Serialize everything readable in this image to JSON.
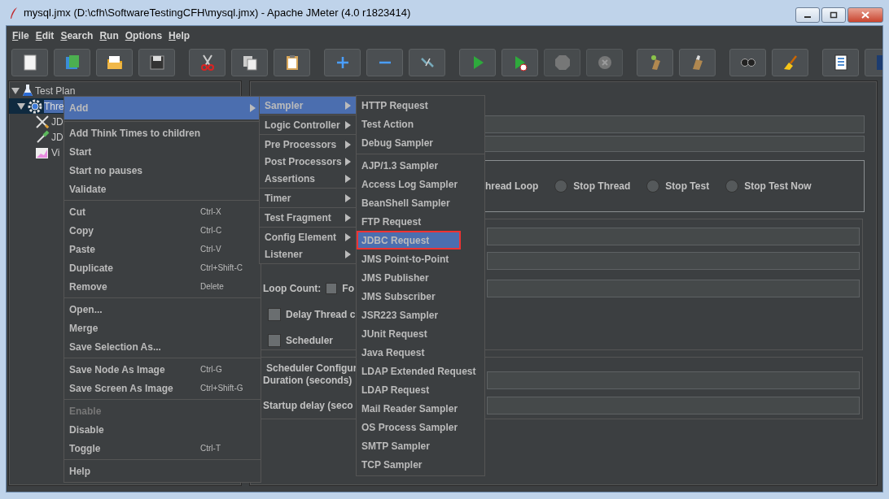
{
  "window": {
    "title": "mysql.jmx (D:\\cfh\\SoftwareTestingCFH\\mysql.jmx) - Apache JMeter (4.0 r1823414)"
  },
  "menu_bar": [
    "File",
    "Edit",
    "Search",
    "Run",
    "Options",
    "Help"
  ],
  "toolbar": [
    {
      "buttons": [
        {
          "kind": "new",
          "disabled": false
        },
        {
          "kind": "templates",
          "disabled": false
        },
        {
          "kind": "open",
          "disabled": false
        },
        {
          "kind": "save",
          "disabled": false
        }
      ]
    },
    {
      "buttons": [
        {
          "kind": "cut",
          "disabled": false
        },
        {
          "kind": "copy",
          "disabled": false
        },
        {
          "kind": "paste",
          "disabled": false
        }
      ]
    },
    {
      "buttons": [
        {
          "kind": "expand",
          "disabled": false
        },
        {
          "kind": "collapse",
          "disabled": false
        },
        {
          "kind": "toggle",
          "disabled": false
        }
      ]
    },
    {
      "buttons": [
        {
          "kind": "start",
          "disabled": false
        },
        {
          "kind": "start-no-pauses",
          "disabled": false
        },
        {
          "kind": "stop",
          "disabled": true
        },
        {
          "kind": "shutdown",
          "disabled": true
        }
      ]
    },
    {
      "buttons": [
        {
          "kind": "clear",
          "disabled": false
        },
        {
          "kind": "clear-all",
          "disabled": false
        }
      ]
    },
    {
      "buttons": [
        {
          "kind": "search",
          "disabled": false
        },
        {
          "kind": "reset-search",
          "disabled": false
        }
      ]
    },
    {
      "buttons": [
        {
          "kind": "function-helper",
          "disabled": false
        },
        {
          "kind": "help",
          "disabled": false
        }
      ]
    }
  ],
  "tree": [
    {
      "label": "Test Plan",
      "kind": "plan",
      "selected": false,
      "expanded": true,
      "children": [
        {
          "label": "Thre",
          "kind": "thread-group",
          "selected": true,
          "expanded": true,
          "children": [
            {
              "label": "JD",
              "kind": "config",
              "selected": false
            },
            {
              "label": "JD",
              "kind": "sampler",
              "selected": false
            },
            {
              "label": "Vi",
              "kind": "listener",
              "selected": false
            }
          ]
        }
      ]
    }
  ],
  "thread_group": {
    "action_partial_label": "hread Loop",
    "actions": [
      {
        "label": "Stop Thread",
        "selected": false
      },
      {
        "label": "Stop Test",
        "selected": false
      },
      {
        "label": "Stop Test Now",
        "selected": false
      }
    ],
    "loop_count": {
      "label": "Loop Count:",
      "checkbox_label": "Fo",
      "checked": false
    },
    "delay_thread": {
      "label": "Delay Thread c",
      "checked": false
    },
    "scheduler": {
      "label": "Scheduler",
      "checked": false
    },
    "scheduler_config": {
      "title": "Scheduler Configur",
      "duration_label": "Duration (seconds)",
      "startup_delay_label": "Startup delay (seco"
    }
  },
  "context_menu": {
    "groups": [
      {
        "items": [
          {
            "label": "Add",
            "submenu": true,
            "selected": true,
            "disabled": false
          }
        ]
      },
      {
        "items": [
          {
            "label": "Add Think Times to children",
            "submenu": false,
            "selected": false,
            "disabled": false
          },
          {
            "label": "Start",
            "submenu": false,
            "selected": false,
            "disabled": false
          },
          {
            "label": "Start no pauses",
            "submenu": false,
            "selected": false,
            "disabled": false
          },
          {
            "label": "Validate",
            "submenu": false,
            "selected": false,
            "disabled": false
          }
        ]
      },
      {
        "items": [
          {
            "label": "Cut",
            "shortcut": "Ctrl-X",
            "submenu": false,
            "selected": false,
            "disabled": false
          },
          {
            "label": "Copy",
            "shortcut": "Ctrl-C",
            "submenu": false,
            "selected": false,
            "disabled": false
          },
          {
            "label": "Paste",
            "shortcut": "Ctrl-V",
            "submenu": false,
            "selected": false,
            "disabled": false
          },
          {
            "label": "Duplicate",
            "shortcut": "Ctrl+Shift-C",
            "submenu": false,
            "selected": false,
            "disabled": false
          },
          {
            "label": "Remove",
            "shortcut": "Delete",
            "submenu": false,
            "selected": false,
            "disabled": false
          }
        ]
      },
      {
        "items": [
          {
            "label": "Open...",
            "submenu": false,
            "selected": false,
            "disabled": false
          },
          {
            "label": "Merge",
            "submenu": false,
            "selected": false,
            "disabled": false
          },
          {
            "label": "Save Selection As...",
            "submenu": false,
            "selected": false,
            "disabled": false
          }
        ]
      },
      {
        "items": [
          {
            "label": "Save Node As Image",
            "shortcut": "Ctrl-G",
            "submenu": false,
            "selected": false,
            "disabled": false
          },
          {
            "label": "Save Screen As Image",
            "shortcut": "Ctrl+Shift-G",
            "submenu": false,
            "selected": false,
            "disabled": false
          }
        ]
      },
      {
        "items": [
          {
            "label": "Enable",
            "submenu": false,
            "selected": false,
            "disabled": true
          },
          {
            "label": "Disable",
            "submenu": false,
            "selected": false,
            "disabled": false
          },
          {
            "label": "Toggle",
            "shortcut": "Ctrl-T",
            "submenu": false,
            "selected": false,
            "disabled": false
          }
        ]
      },
      {
        "items": [
          {
            "label": "Help",
            "submenu": false,
            "selected": false,
            "disabled": false
          }
        ]
      }
    ]
  },
  "add_menu": {
    "groups": [
      {
        "items": [
          {
            "label": "Sampler",
            "submenu": true,
            "selected": true,
            "disabled": false
          }
        ]
      },
      {
        "items": [
          {
            "label": "Logic Controller",
            "submenu": true,
            "selected": false,
            "disabled": false
          }
        ]
      },
      {
        "items": [
          {
            "label": "Pre Processors",
            "submenu": true,
            "selected": false,
            "disabled": false
          },
          {
            "label": "Post Processors",
            "submenu": true,
            "selected": false,
            "disabled": false
          },
          {
            "label": "Assertions",
            "submenu": true,
            "selected": false,
            "disabled": false
          }
        ]
      },
      {
        "items": [
          {
            "label": "Timer",
            "submenu": true,
            "selected": false,
            "disabled": false
          }
        ]
      },
      {
        "items": [
          {
            "label": "Test Fragment",
            "submenu": true,
            "selected": false,
            "disabled": false
          }
        ]
      },
      {
        "items": [
          {
            "label": "Config Element",
            "submenu": true,
            "selected": false,
            "disabled": false
          },
          {
            "label": "Listener",
            "submenu": true,
            "selected": false,
            "disabled": false
          }
        ]
      }
    ]
  },
  "sampler_menu": {
    "groups": [
      {
        "items": [
          {
            "label": "HTTP Request",
            "selected": false,
            "annotated": false
          },
          {
            "label": "Test Action",
            "selected": false,
            "annotated": false
          },
          {
            "label": "Debug Sampler",
            "selected": false,
            "annotated": false
          }
        ]
      },
      {
        "items": [
          {
            "label": "AJP/1.3 Sampler",
            "selected": false,
            "annotated": false
          },
          {
            "label": "Access Log Sampler",
            "selected": false,
            "annotated": false
          },
          {
            "label": "BeanShell Sampler",
            "selected": false,
            "annotated": false
          },
          {
            "label": "FTP Request",
            "selected": false,
            "annotated": false
          },
          {
            "label": "JDBC Request",
            "selected": true,
            "annotated": true
          },
          {
            "label": "JMS Point-to-Point",
            "selected": false,
            "annotated": false
          },
          {
            "label": "JMS Publisher",
            "selected": false,
            "annotated": false
          },
          {
            "label": "JMS Subscriber",
            "selected": false,
            "annotated": false
          },
          {
            "label": "JSR223 Sampler",
            "selected": false,
            "annotated": false
          },
          {
            "label": "JUnit Request",
            "selected": false,
            "annotated": false
          },
          {
            "label": "Java Request",
            "selected": false,
            "annotated": false
          },
          {
            "label": "LDAP Extended Request",
            "selected": false,
            "annotated": false
          },
          {
            "label": "LDAP Request",
            "selected": false,
            "annotated": false
          },
          {
            "label": "Mail Reader Sampler",
            "selected": false,
            "annotated": false
          },
          {
            "label": "OS Process Sampler",
            "selected": false,
            "annotated": false
          },
          {
            "label": "SMTP Sampler",
            "selected": false,
            "annotated": false
          },
          {
            "label": "TCP Sampler",
            "selected": false,
            "annotated": false
          }
        ]
      }
    ]
  }
}
